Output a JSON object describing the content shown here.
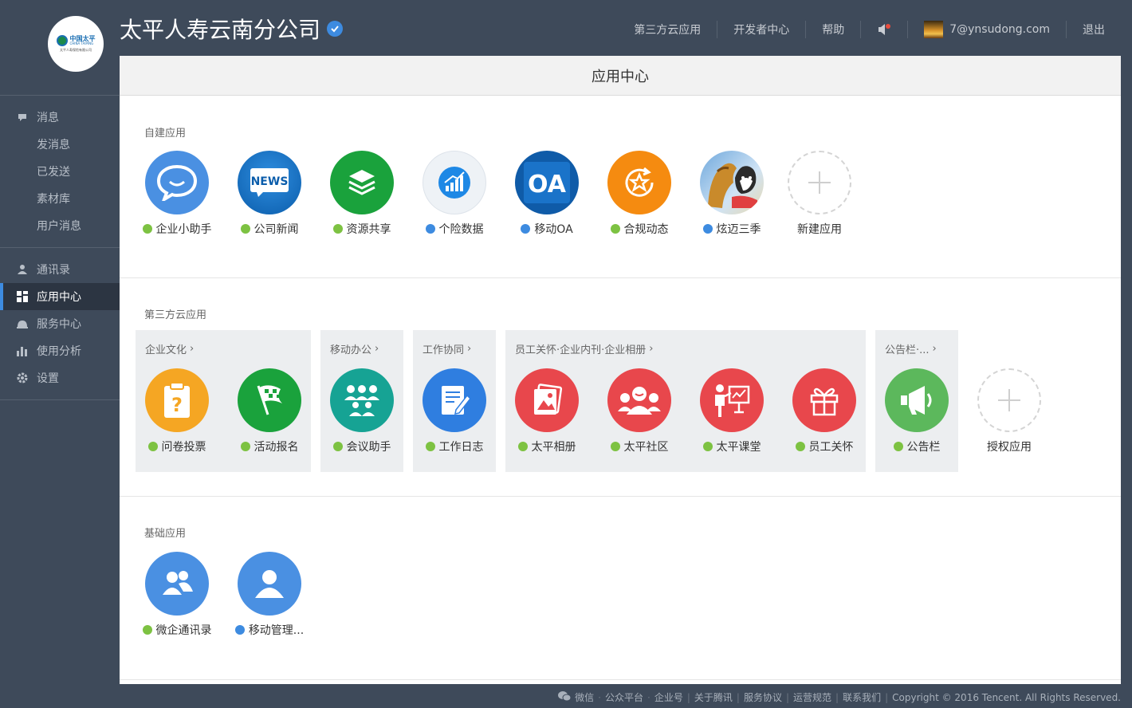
{
  "header": {
    "company_name": "太平人寿云南分公司",
    "logo": {
      "cn": "中国太平",
      "en": "CHINA TAIPING",
      "sub": "太平人寿保险有限公司"
    },
    "nav": {
      "third_party": "第三方云应用",
      "developer": "开发者中心",
      "help": "帮助",
      "user_email": "7@ynsudong.com",
      "logout": "退出"
    }
  },
  "sidebar": {
    "messages": {
      "label": "消息",
      "items": [
        "发消息",
        "已发送",
        "素材库",
        "用户消息"
      ]
    },
    "contacts": "通讯录",
    "app_center": "应用中心",
    "service_center": "服务中心",
    "analytics": "使用分析",
    "settings": "设置"
  },
  "main": {
    "title": "应用中心",
    "self_built": {
      "title": "自建应用",
      "apps": [
        {
          "label": "企业小助手",
          "badge": "green"
        },
        {
          "label": "公司新闻",
          "badge": "green"
        },
        {
          "label": "资源共享",
          "badge": "green"
        },
        {
          "label": "个险数据",
          "badge": "blue"
        },
        {
          "label": "移动OA",
          "badge": "blue"
        },
        {
          "label": "合规动态",
          "badge": "green"
        },
        {
          "label": "炫迈三季",
          "badge": "blue"
        }
      ],
      "add_label": "新建应用"
    },
    "third_party": {
      "title": "第三方云应用",
      "categories": [
        "企业文化",
        "移动办公",
        "工作协同",
        "员工关怀·企业内刊·企业相册",
        "公告栏·..."
      ],
      "apps": [
        {
          "label": "问卷投票",
          "badge": "green"
        },
        {
          "label": "活动报名",
          "badge": "green"
        },
        {
          "label": "会议助手",
          "badge": "green"
        },
        {
          "label": "工作日志",
          "badge": "green"
        },
        {
          "label": "太平相册",
          "badge": "green"
        },
        {
          "label": "太平社区",
          "badge": "green"
        },
        {
          "label": "太平课堂",
          "badge": "green"
        },
        {
          "label": "员工关怀",
          "badge": "green"
        },
        {
          "label": "公告栏",
          "badge": "green"
        }
      ],
      "add_label": "授权应用"
    },
    "basic": {
      "title": "基础应用",
      "apps": [
        {
          "label": "微企通讯录",
          "badge": "green"
        },
        {
          "label": "移动管理...",
          "badge": "blue"
        }
      ]
    },
    "colors": {
      "accent": "#3d8be0",
      "badge_green": "#7dc242",
      "sidebar_bg": "#3e4a5a"
    }
  },
  "footer": {
    "links": [
      "微信",
      "公众平台",
      "企业号",
      "关于腾讯",
      "服务协议",
      "运营规范",
      "联系我们"
    ],
    "copyright": "Copyright © 2016 Tencent. All Rights Reserved."
  }
}
